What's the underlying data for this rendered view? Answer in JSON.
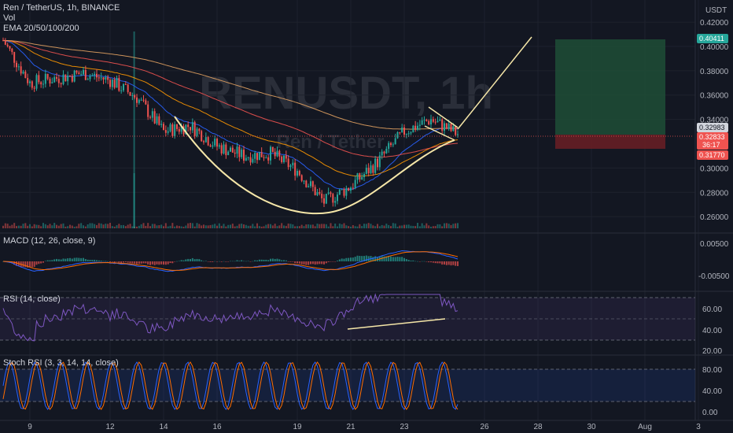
{
  "header": {
    "symbol_line": "Ren / TetherUS, 1h, BINANCE",
    "vol_label": "Vol",
    "ema_label": "EMA 20/50/100/200"
  },
  "currency": "USDT",
  "watermark": {
    "main": "RENUSDT, 1h",
    "sub": "Ren / Tether"
  },
  "panes": {
    "macd": {
      "label": "MACD (12, 26, close, 9)",
      "ticks": [
        "0.00500",
        "-0.00500"
      ]
    },
    "rsi": {
      "label": "RSI (14, close)",
      "ticks": [
        "60.00",
        "40.00",
        "20.00"
      ]
    },
    "stoch": {
      "label": "Stoch RSI (3, 3, 14, 14, close)",
      "ticks": [
        "80.00",
        "40.00",
        "0.00"
      ]
    }
  },
  "tags": {
    "target": "0.40411",
    "current": "0.32983",
    "price": "0.32833",
    "countdown": "36:17",
    "stop": "0.31770"
  },
  "colors": {
    "bg": "#131722",
    "up": "#26a69a",
    "down": "#ef5350",
    "grid": "#1e222d",
    "ema20": "#2962ff",
    "ema50": "#ff9800",
    "ema100": "#ef5350",
    "ema200": "#e0a060",
    "pattern": "#f5e6a8",
    "macd": "#2962ff",
    "signal": "#ff6d00",
    "rsi": "#7e57c2",
    "stoch_k": "#2962ff",
    "stoch_d": "#ff6d00",
    "profit": "#1e4d36",
    "loss": "#6b1f24"
  },
  "chart_data": {
    "type": "candlestick",
    "title": "Ren / TetherUS, 1h, BINANCE",
    "y_axis_ticks": [
      "0.42000",
      "0.40000",
      "0.38000",
      "0.36000",
      "0.34000",
      "0.30000",
      "0.28000",
      "0.26000"
    ],
    "x_axis_ticks": [
      "9",
      "12",
      "14",
      "16",
      "19",
      "21",
      "23",
      "26",
      "28",
      "30",
      "Aug",
      "3"
    ],
    "ylim": [
      0.253,
      0.433
    ],
    "price_path_approx": [
      {
        "x": "8",
        "y": 0.405
      },
      {
        "x": "9",
        "y": 0.37
      },
      {
        "x": "11",
        "y": 0.378
      },
      {
        "x": "12",
        "y": 0.372
      },
      {
        "x": "13",
        "y": 0.358
      },
      {
        "x": "14",
        "y": 0.33
      },
      {
        "x": "15",
        "y": 0.335
      },
      {
        "x": "16",
        "y": 0.318
      },
      {
        "x": "17",
        "y": 0.31
      },
      {
        "x": "18",
        "y": 0.312
      },
      {
        "x": "19",
        "y": 0.298
      },
      {
        "x": "20",
        "y": 0.272
      },
      {
        "x": "21",
        "y": 0.285
      },
      {
        "x": "22",
        "y": 0.305
      },
      {
        "x": "23",
        "y": 0.33
      },
      {
        "x": "24",
        "y": 0.34
      },
      {
        "x": "25",
        "y": 0.328
      }
    ],
    "position_tool": {
      "entry": 0.32833,
      "target": 0.40411,
      "stop": 0.3177
    },
    "annotations": [
      "cup-and-handle curve",
      "handle trendlines",
      "projected breakout line",
      "RSI rising trendline"
    ]
  }
}
